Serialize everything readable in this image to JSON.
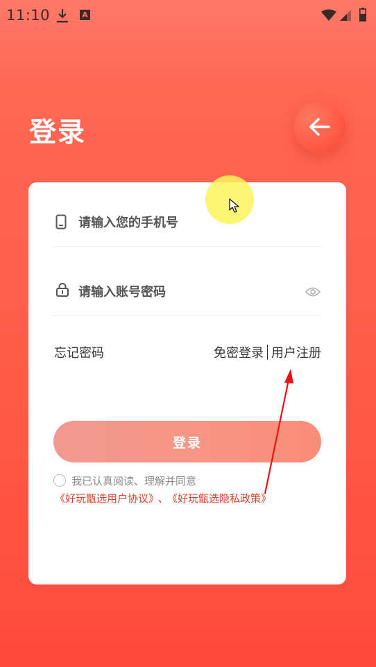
{
  "status_bar": {
    "time": "11:10",
    "icons": [
      "download-icon",
      "app-notification-icon",
      "wifi-icon",
      "signal-icon",
      "battery-icon"
    ],
    "app_icon_letter": "A"
  },
  "header": {
    "title": "登录",
    "back_icon": "arrow-left-icon"
  },
  "form": {
    "phone_placeholder": "请输入您的手机号",
    "phone_value": "",
    "password_placeholder": "请输入账号密码",
    "password_value": "",
    "phone_icon": "phone-icon",
    "lock_icon": "lock-icon",
    "eye_icon": "eye-icon"
  },
  "links": {
    "forgot_password": "忘记密码",
    "passwordless_login": "免密登录",
    "register": "用户注册"
  },
  "login_button": "登录",
  "agreement": {
    "text": "我已认真阅读、理解并同意",
    "user_agreement": "《好玩甑选用户协议》",
    "separator": "、",
    "privacy_policy": "《好玩甑选隐私政策》",
    "checked": false
  },
  "colors": {
    "background_top": "#ff6a57",
    "background_bottom": "#ff4a3b",
    "card": "#ffffff",
    "link_red": "#d9412b",
    "login_button": "#f79080",
    "annotation_arrow": "#ee1111",
    "touch_indicator": "#faf55a"
  }
}
